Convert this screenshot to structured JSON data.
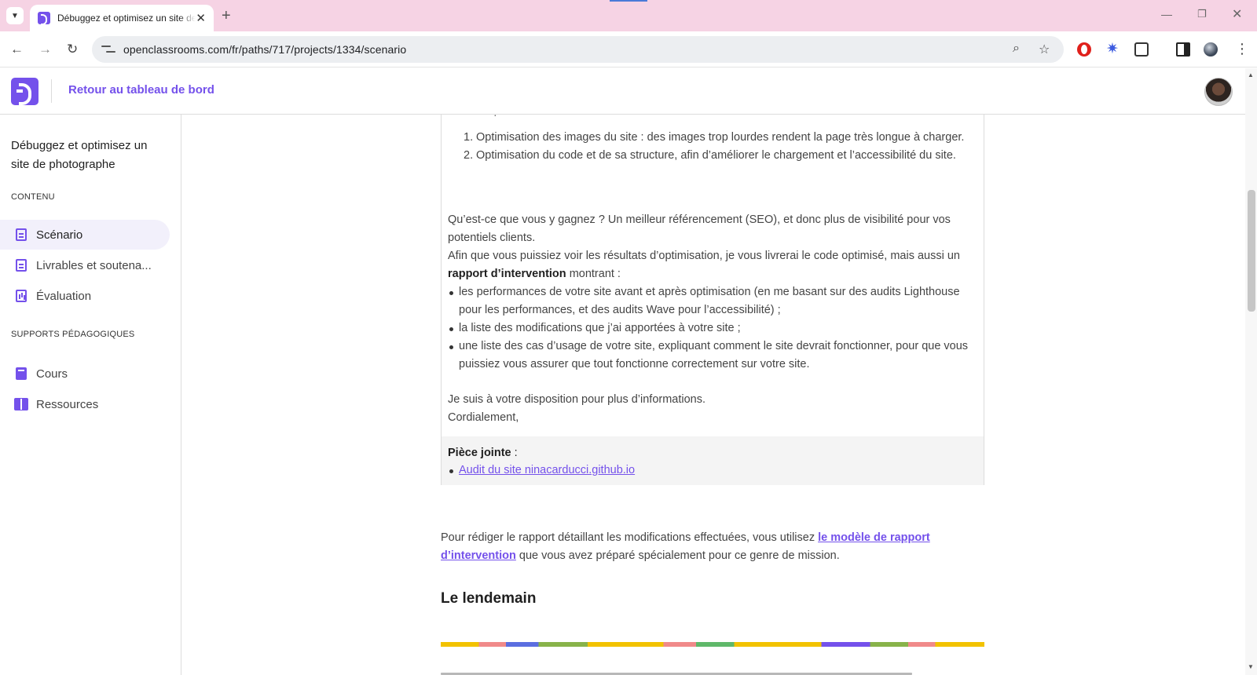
{
  "browser": {
    "tab_title": "Débuggez et optimisez un site de photographe",
    "url": "openclassrooms.com/fr/paths/717/projects/1334/scenario"
  },
  "header": {
    "back_label": "Retour au tableau de bord"
  },
  "sidebar": {
    "course_title": "Débuggez et optimisez un site de photographe",
    "content_label": "CONTENU",
    "content_items": [
      {
        "label": "Scénario",
        "icon": "document-icon",
        "active": true
      },
      {
        "label": "Livrables et soutena...",
        "icon": "document-icon",
        "active": false
      },
      {
        "label": "Évaluation",
        "icon": "chart-icon",
        "active": false
      }
    ],
    "supports_label": "SUPPORTS PÉDAGOGIQUES",
    "support_items": [
      {
        "label": "Cours",
        "icon": "book-icon"
      },
      {
        "label": "Ressources",
        "icon": "resources-icon"
      }
    ]
  },
  "letter": {
    "list_ordered": [
      {
        "num": "1.",
        "text": "Optimisation des images du site : des images trop lourdes rendent la page très longue à charger."
      },
      {
        "num": "2.",
        "text": "Optimisation du code et de sa structure, afin d’améliorer le chargement et l’accessibilité du site."
      }
    ],
    "gain_paragraph": "Qu’est-ce que vous y gagnez ? Un meilleur référencement (SEO), et donc plus de visibilité pour vos potentiels clients.",
    "report_intro_before": "Afin que vous puissiez voir les résultats d’optimisation, je vous livrerai le code optimisé, mais aussi un",
    "report_bold": "rapport d’intervention",
    "report_intro_after": "montrant :",
    "bullets": [
      "les performances de votre site avant et après optimisation (en me basant sur des audits Lighthouse pour les performances, et des audits Wave pour l’accessibilité) ;",
      "la liste des modifications que j’ai apportées à votre site ;",
      "une liste des cas d’usage de votre site, expliquant comment le site devrait fonctionner, pour que vous puissiez vous assurer que tout fonctionne correctement sur votre site."
    ],
    "closing_line": "Je suis à votre disposition pour plus d’informations.",
    "signoff": "Cordialement,",
    "attachment_label": "Pièce jointe",
    "attachment_colon": " :",
    "attachment_link": "Audit du site ninacarducci.github.io"
  },
  "body": {
    "outro_before": "Pour rédiger le rapport détaillant les modifications effectuées, vous utilisez",
    "outro_link": "le modèle de rapport d’intervention",
    "outro_after": "que vous avez préparé spécialement pour ce genre de mission.",
    "next_heading": "Le lendemain"
  },
  "colors": {
    "brand": "#7451eb",
    "tabbar": "#f6d3e4"
  }
}
